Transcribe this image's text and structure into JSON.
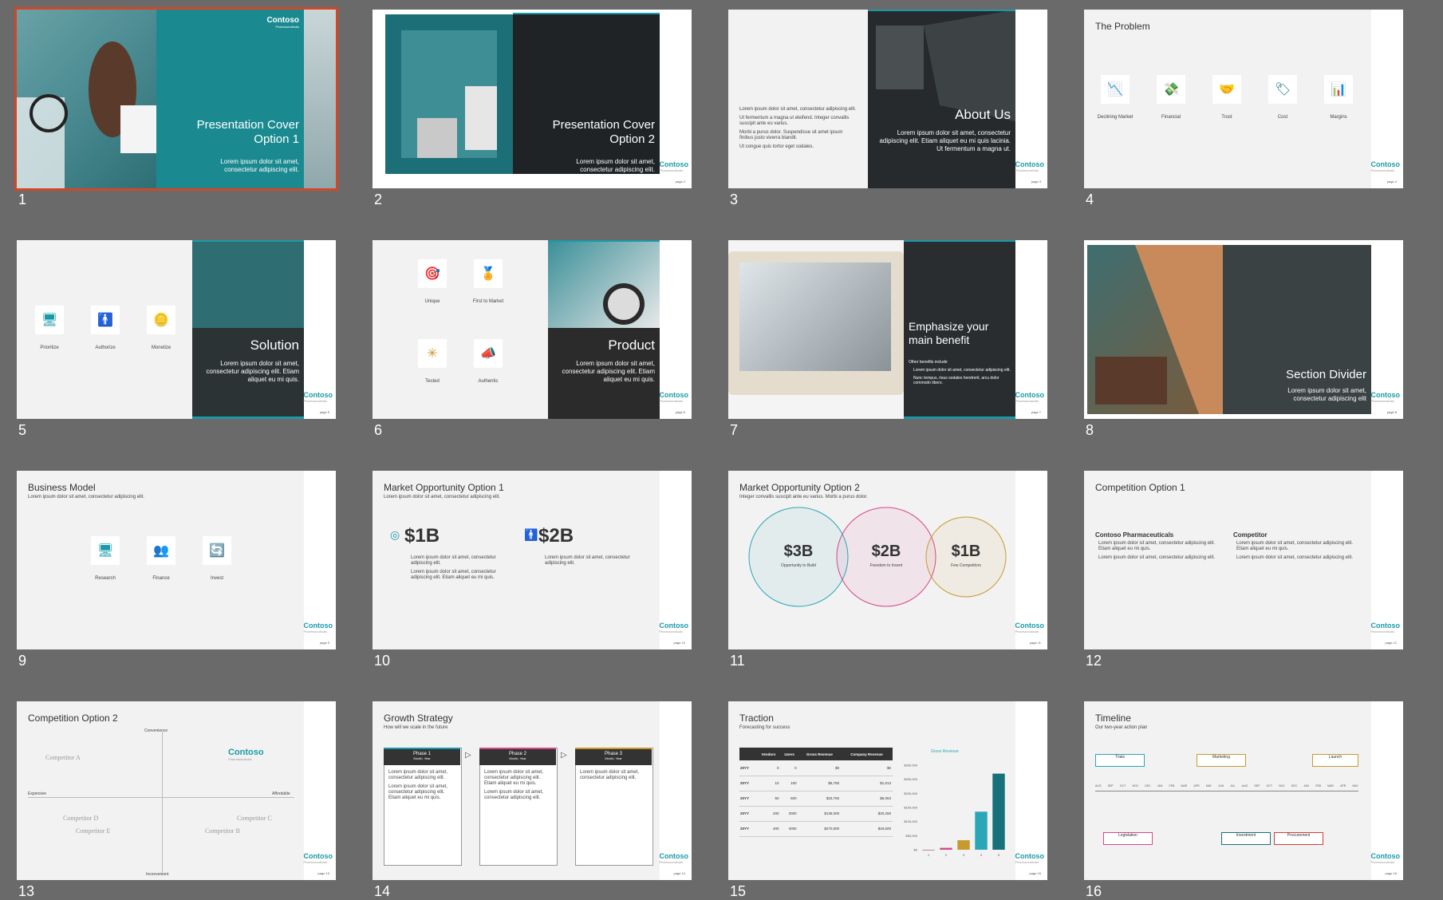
{
  "brand": {
    "name": "Contoso",
    "tagline": "Pharmaceuticals",
    "accent": "#1a9aa8",
    "selection": "#d24726"
  },
  "lorem": {
    "short": "Lorem ipsum dolor sit amet, consectetur adipiscing elit.",
    "short2": "Lorem ipsum dolor sit amet, consectetur adipiscing elit. Etiam aliquet eu mi quis."
  },
  "slides": [
    {
      "num": "1",
      "title": "Presentation Cover Option 1",
      "body": "Lorem ipsum dolor sit amet, consectetur adipiscing elit."
    },
    {
      "num": "2",
      "title": "Presentation Cover Option 2",
      "body": "Lorem ipsum dolor sit amet, consectetur adipiscing elit.",
      "page": "page 2"
    },
    {
      "num": "3",
      "title": "About Us",
      "body": "Lorem ipsum dolor sit amet, consectetur adipiscing elit. Etiam aliquet eu mi quis lacinia. Ut fermentum a magna ut.",
      "bullets": [
        "Lorem ipsum dolor sit amet, consectetur adipiscing elit.",
        "Ut fermentum a magna ut eleifend. Integer convallis suscipit ante eu varius.",
        "Morbi a purus dolor. Suspendisse sit amet ipsum finibus justo viverra blandit.",
        "Ut congue quis tortor eget sodales."
      ],
      "page": "page 3"
    },
    {
      "num": "4",
      "title": "The Problem",
      "icons": [
        "Declining Market",
        "Financial",
        "Trust",
        "Cost",
        "Margins"
      ],
      "page": "page 4"
    },
    {
      "num": "5",
      "title": "Solution",
      "body": "Lorem ipsum dolor sit amet, consectetur adipiscing elit. Etiam aliquet eu mi quis.",
      "icons": [
        "Prioritize",
        "Authorize",
        "Monetize"
      ],
      "page": "page 5"
    },
    {
      "num": "6",
      "title": "Product",
      "body": "Lorem ipsum dolor sit amet, consectetur adipiscing elit. Etiam aliquet eu mi quis.",
      "icons": [
        "Unique",
        "First to Market",
        "Tested",
        "Authentic"
      ],
      "page": "page 6"
    },
    {
      "num": "7",
      "title": "Emphasize your main benefit",
      "intro": "Other benefits include",
      "bullets": [
        "Lorem ipsum dolor sit amet, consectetur adipiscing elit.",
        "Nunc tempus, risus sodales hendrerit, arcu dolor commodo libero."
      ],
      "page": "page 7"
    },
    {
      "num": "8",
      "title": "Section Divider",
      "body": "Lorem ipsum dolor sit amet, consectetur adipiscing elit",
      "page": "page 8"
    },
    {
      "num": "9",
      "title": "Business Model",
      "sub": "Lorem ipsum dolor sit amet, consectetur adipiscing elit.",
      "icons": [
        "Research",
        "Finance",
        "Invest"
      ],
      "page": "page 9"
    },
    {
      "num": "10",
      "title": "Market Opportunity Option 1",
      "sub": "Lorem ipsum dolor sit amet, consectetur adipiscing elit.",
      "v1": "$1B",
      "v2": "$2B",
      "page": "page 10"
    },
    {
      "num": "11",
      "title": "Market Opportunity Option 2",
      "sub": "Integer convallis suscipit ante eu varius. Morbi a purus dolor.",
      "circles": [
        {
          "v": "$3B",
          "l": "Opportunity to Build",
          "c": "#2aa6b8"
        },
        {
          "v": "$2B",
          "l": "Freedom to Invent",
          "c": "#d6468a"
        },
        {
          "v": "$1B",
          "l": "Few Competitors",
          "c": "#c79a2e"
        }
      ],
      "page": "page 11"
    },
    {
      "num": "12",
      "title": "Competition Option 1",
      "col1": "Contoso Pharmaceuticals",
      "col2": "Competitor",
      "page": "page 12"
    },
    {
      "num": "13",
      "title": "Competition Option 2",
      "axes": {
        "top": "Convenience",
        "bottom": "Inconvenient",
        "left": "Expensive",
        "right": "Affordable"
      },
      "competitors": [
        "Competitor A",
        "Competitor B",
        "Competitor C",
        "Competitor D",
        "Competitor E"
      ],
      "page": "page 13"
    },
    {
      "num": "14",
      "title": "Growth Strategy",
      "sub": "How will we scale in the future",
      "phases": [
        {
          "n": "Phase 1",
          "d": "Month, Year",
          "c": "#1a9aa8"
        },
        {
          "n": "Phase 2",
          "d": "Month, Year",
          "c": "#d6468a"
        },
        {
          "n": "Phase 3",
          "d": "Month, Year",
          "c": "#c79a2e"
        }
      ],
      "page": "page 14"
    },
    {
      "num": "15",
      "title": "Traction",
      "sub": "Forecasting for success",
      "chartTitle": "Gross Revenue",
      "cols": [
        "Vendors",
        "Users",
        "Gross Revenue",
        "Company Revenue"
      ],
      "rows": [
        [
          "20YY",
          "0",
          "0",
          "$0",
          "$0"
        ],
        [
          "20YY",
          "10",
          "100",
          "$6,750",
          "$1,013"
        ],
        [
          "20YY",
          "50",
          "500",
          "$33,750",
          "$5,063"
        ],
        [
          "20YY",
          "200",
          "2000",
          "$135,000",
          "$20,250"
        ],
        [
          "20YY",
          "400",
          "4000",
          "$270,000",
          "$40,500"
        ]
      ],
      "page": "page 15"
    },
    {
      "num": "16",
      "title": "Timeline",
      "sub": "Our two-year action plan",
      "months": [
        "AUG",
        "SEP",
        "OCT",
        "NOV",
        "DEC",
        "JAN",
        "FEB",
        "MAR",
        "APR",
        "MAY",
        "JUN",
        "JUL",
        "AUG",
        "SEP",
        "OCT",
        "NOV",
        "DEC",
        "JAN",
        "FEB",
        "MAR",
        "APR",
        "MAY"
      ],
      "milestones": [
        {
          "l": "Trials",
          "c": "#2aa6b8"
        },
        {
          "l": "Marketing",
          "c": "#c79a2e"
        },
        {
          "l": "Launch",
          "c": "#c79a2e"
        },
        {
          "l": "Legislation",
          "c": "#d6468a"
        },
        {
          "l": "Investment",
          "c": "#17707a"
        },
        {
          "l": "Procurement",
          "c": "#d63c3c"
        }
      ],
      "page": "page 16"
    }
  ],
  "chart_data": {
    "type": "bar",
    "title": "Gross Revenue",
    "categories": [
      "1",
      "2",
      "3",
      "4",
      "5"
    ],
    "values": [
      0,
      6750,
      33750,
      135000,
      270000
    ],
    "ylim": [
      0,
      300000
    ],
    "yticks": [
      "$0",
      "$50,000",
      "$100,000",
      "$150,000",
      "$200,000",
      "$250,000",
      "$300,000"
    ],
    "colors": [
      "#7a2a4a",
      "#d6468a",
      "#c79a2e",
      "#2aa6b8",
      "#17707a"
    ]
  }
}
